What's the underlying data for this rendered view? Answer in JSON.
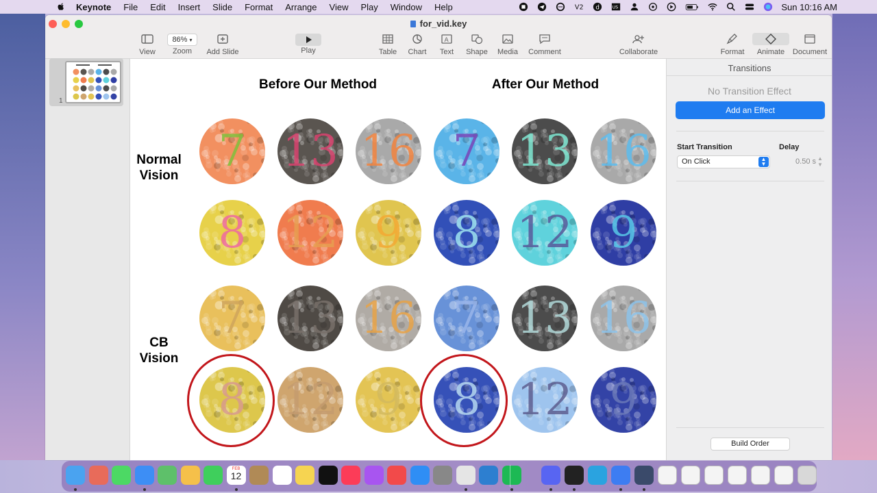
{
  "menubar": {
    "app_name": "Keynote",
    "items": [
      "File",
      "Edit",
      "Insert",
      "Slide",
      "Format",
      "Arrange",
      "View",
      "Play",
      "Window",
      "Help"
    ],
    "clock": "Sun  10:16 AM"
  },
  "window": {
    "title": "for_vid.key",
    "toolbar": {
      "view": "View",
      "zoom_value": "86%",
      "zoom": "Zoom",
      "add_slide": "Add Slide",
      "play": "Play",
      "table": "Table",
      "chart": "Chart",
      "text": "Text",
      "shape": "Shape",
      "media": "Media",
      "comment": "Comment",
      "collaborate": "Collaborate",
      "format": "Format",
      "animate": "Animate",
      "document": "Document"
    }
  },
  "navigator": {
    "slide_number": "1"
  },
  "slide": {
    "heading_before": "Before Our Method",
    "heading_after": "After Our Method",
    "label_normal": "Normal Vision",
    "label_cb": "CB Vision",
    "plates": [
      {
        "num": "7"
      },
      {
        "num": "13"
      },
      {
        "num": "16"
      },
      {
        "num": "7"
      },
      {
        "num": "13"
      },
      {
        "num": "16"
      },
      {
        "num": "8"
      },
      {
        "num": "12"
      },
      {
        "num": "9"
      },
      {
        "num": "8"
      },
      {
        "num": "12"
      },
      {
        "num": "9"
      },
      {
        "num": "7"
      },
      {
        "num": "13"
      },
      {
        "num": "16"
      },
      {
        "num": "7"
      },
      {
        "num": "13"
      },
      {
        "num": "16"
      },
      {
        "num": "8"
      },
      {
        "num": "12"
      },
      {
        "num": "9"
      },
      {
        "num": "8"
      },
      {
        "num": "12"
      },
      {
        "num": "9"
      }
    ]
  },
  "inspector": {
    "title": "Transitions",
    "no_effect": "No Transition Effect",
    "add_effect": "Add an Effect",
    "start_transition_label": "Start Transition",
    "start_transition_value": "On Click",
    "delay_label": "Delay",
    "delay_value": "0.50 s",
    "build_order": "Build Order"
  },
  "dock": {
    "apps": [
      "finder-icon",
      "launchpad-icon",
      "messages-icon",
      "mail-icon",
      "maps-icon",
      "photos-icon",
      "facetime-icon",
      "calendar-icon",
      "notes-app-icon",
      "reminders-icon",
      "notes-icon",
      "apple-tv-icon",
      "music-icon",
      "podcasts-icon",
      "news-icon",
      "app-store-icon",
      "system-preferences-icon",
      "chrome-icon",
      "vscode-icon",
      "spotify-icon",
      "discord-icon",
      "terminal-icon",
      "telegram-icon",
      "keynote-icon",
      "quicktime-icon"
    ],
    "calendar_month": "FEB",
    "calendar_day": "12"
  },
  "colors": {
    "accent": "#1f7cf0",
    "highlight_ring": "#c2161b"
  }
}
